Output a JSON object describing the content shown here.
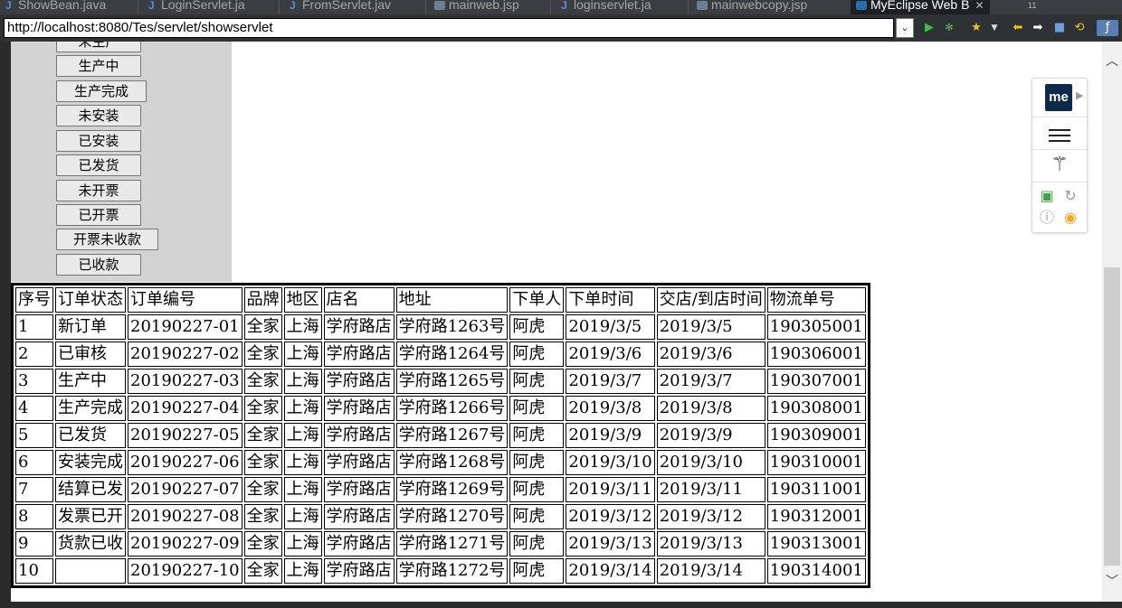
{
  "tabs": [
    {
      "label": "ShowBean.java",
      "icon": "java-file-icon"
    },
    {
      "label": "LoginServlet.ja",
      "icon": "java-file-icon"
    },
    {
      "label": "FromServlet.jav",
      "icon": "java-file-icon"
    },
    {
      "label": "mainweb.jsp",
      "icon": "jsp-file-icon"
    },
    {
      "label": "loginservlet.ja",
      "icon": "java-file-icon"
    },
    {
      "label": "mainwebcopy.jsp",
      "icon": "jsp-file-icon"
    },
    {
      "label": "MyEclipse Web B",
      "icon": "web-browser-icon",
      "active": true
    }
  ],
  "tab_overflow_count": "11",
  "address_bar": {
    "url": "http://localhost:8080/Tes/servlet/showservlet"
  },
  "status_buttons": [
    "未生产",
    "生产中",
    "生产完成",
    "未安装",
    "已安装",
    "已发货",
    "未开票",
    "已开票",
    "开票未收款",
    "已收款"
  ],
  "order_table": {
    "headers": [
      "序号",
      "订单状态",
      "订单编号",
      "品牌",
      "地区",
      "店名",
      "地址",
      "下单人",
      "下单时间",
      "交店/到店时间",
      "物流单号"
    ],
    "rows": [
      [
        "1",
        "新订单",
        "20190227-01",
        "全家",
        "上海",
        "学府路店",
        "学府路1263号",
        "阿虎",
        "2019/3/5",
        "2019/3/5",
        "190305001"
      ],
      [
        "2",
        "已审核",
        "20190227-02",
        "全家",
        "上海",
        "学府路店",
        "学府路1264号",
        "阿虎",
        "2019/3/6",
        "2019/3/6",
        "190306001"
      ],
      [
        "3",
        "生产中",
        "20190227-03",
        "全家",
        "上海",
        "学府路店",
        "学府路1265号",
        "阿虎",
        "2019/3/7",
        "2019/3/7",
        "190307001"
      ],
      [
        "4",
        "生产完成",
        "20190227-04",
        "全家",
        "上海",
        "学府路店",
        "学府路1266号",
        "阿虎",
        "2019/3/8",
        "2019/3/8",
        "190308001"
      ],
      [
        "5",
        "已发货",
        "20190227-05",
        "全家",
        "上海",
        "学府路店",
        "学府路1267号",
        "阿虎",
        "2019/3/9",
        "2019/3/9",
        "190309001"
      ],
      [
        "6",
        "安装完成",
        "20190227-06",
        "全家",
        "上海",
        "学府路店",
        "学府路1268号",
        "阿虎",
        "2019/3/10",
        "2019/3/10",
        "190310001"
      ],
      [
        "7",
        "结算已发",
        "20190227-07",
        "全家",
        "上海",
        "学府路店",
        "学府路1269号",
        "阿虎",
        "2019/3/11",
        "2019/3/11",
        "190311001"
      ],
      [
        "8",
        "发票已开",
        "20190227-08",
        "全家",
        "上海",
        "学府路店",
        "学府路1270号",
        "阿虎",
        "2019/3/12",
        "2019/3/12",
        "190312001"
      ],
      [
        "9",
        "货款已收",
        "20190227-09",
        "全家",
        "上海",
        "学府路店",
        "学府路1271号",
        "阿虎",
        "2019/3/13",
        "2019/3/13",
        "190313001"
      ],
      [
        "10",
        "",
        "20190227-10",
        "全家",
        "上海",
        "学府路店",
        "学府路1272号",
        "阿虎",
        "2019/3/14",
        "2019/3/14",
        "190314001"
      ]
    ]
  },
  "extension_toolbar": {
    "logo_text": "me"
  },
  "colors": {
    "side_panel": "#d3d3d3",
    "ide_dark": "#2b2b2b",
    "eye_icon": "#f5a623",
    "cast_icon": "#3aa745"
  }
}
